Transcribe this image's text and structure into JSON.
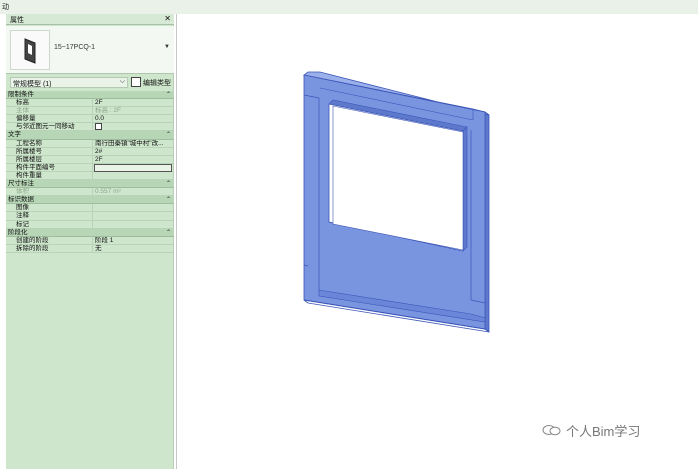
{
  "top_bar": {
    "text": "动"
  },
  "properties": {
    "title": "属性",
    "close_icon": "close-icon",
    "type_name": "15~17PCQ-1",
    "filter_value": "常规模型 (1)",
    "edit_type_label": "编辑类型",
    "groups": [
      {
        "label": "限制条件",
        "rows": [
          {
            "key": "标高",
            "value": "2F"
          },
          {
            "key": "主体",
            "value": "标高 : 2F",
            "disabled": true
          },
          {
            "key": "偏移量",
            "value": "0.0"
          },
          {
            "key": "与邻近图元一同移动",
            "value": "",
            "checkbox": true
          }
        ]
      },
      {
        "label": "文字",
        "rows": [
          {
            "key": "工程名称",
            "value": "南行田秦镇\"城中村\"改..."
          },
          {
            "key": "所属楼号",
            "value": "2#"
          },
          {
            "key": "所属楼层",
            "value": "2F"
          },
          {
            "key": "构件平面编号",
            "value": "",
            "input": true
          },
          {
            "key": "构件重量",
            "value": ""
          }
        ]
      },
      {
        "label": "尺寸标注",
        "rows": [
          {
            "key": "体积",
            "value": "0.557 m³",
            "disabled": true
          }
        ]
      },
      {
        "label": "标识数据",
        "rows": [
          {
            "key": "图像",
            "value": ""
          },
          {
            "key": "注释",
            "value": ""
          },
          {
            "key": "标记",
            "value": ""
          }
        ]
      },
      {
        "label": "阶段化",
        "rows": [
          {
            "key": "创建的阶段",
            "value": "阶段 1"
          },
          {
            "key": "拆除的阶段",
            "value": "无"
          }
        ]
      }
    ]
  },
  "watermark": {
    "text": "个人Bim学习",
    "icon": "wechat-icon"
  },
  "colors": {
    "panel_bg": "#cde6cc",
    "model_fill": "#7a95e0",
    "model_edge": "#3b55b8"
  }
}
